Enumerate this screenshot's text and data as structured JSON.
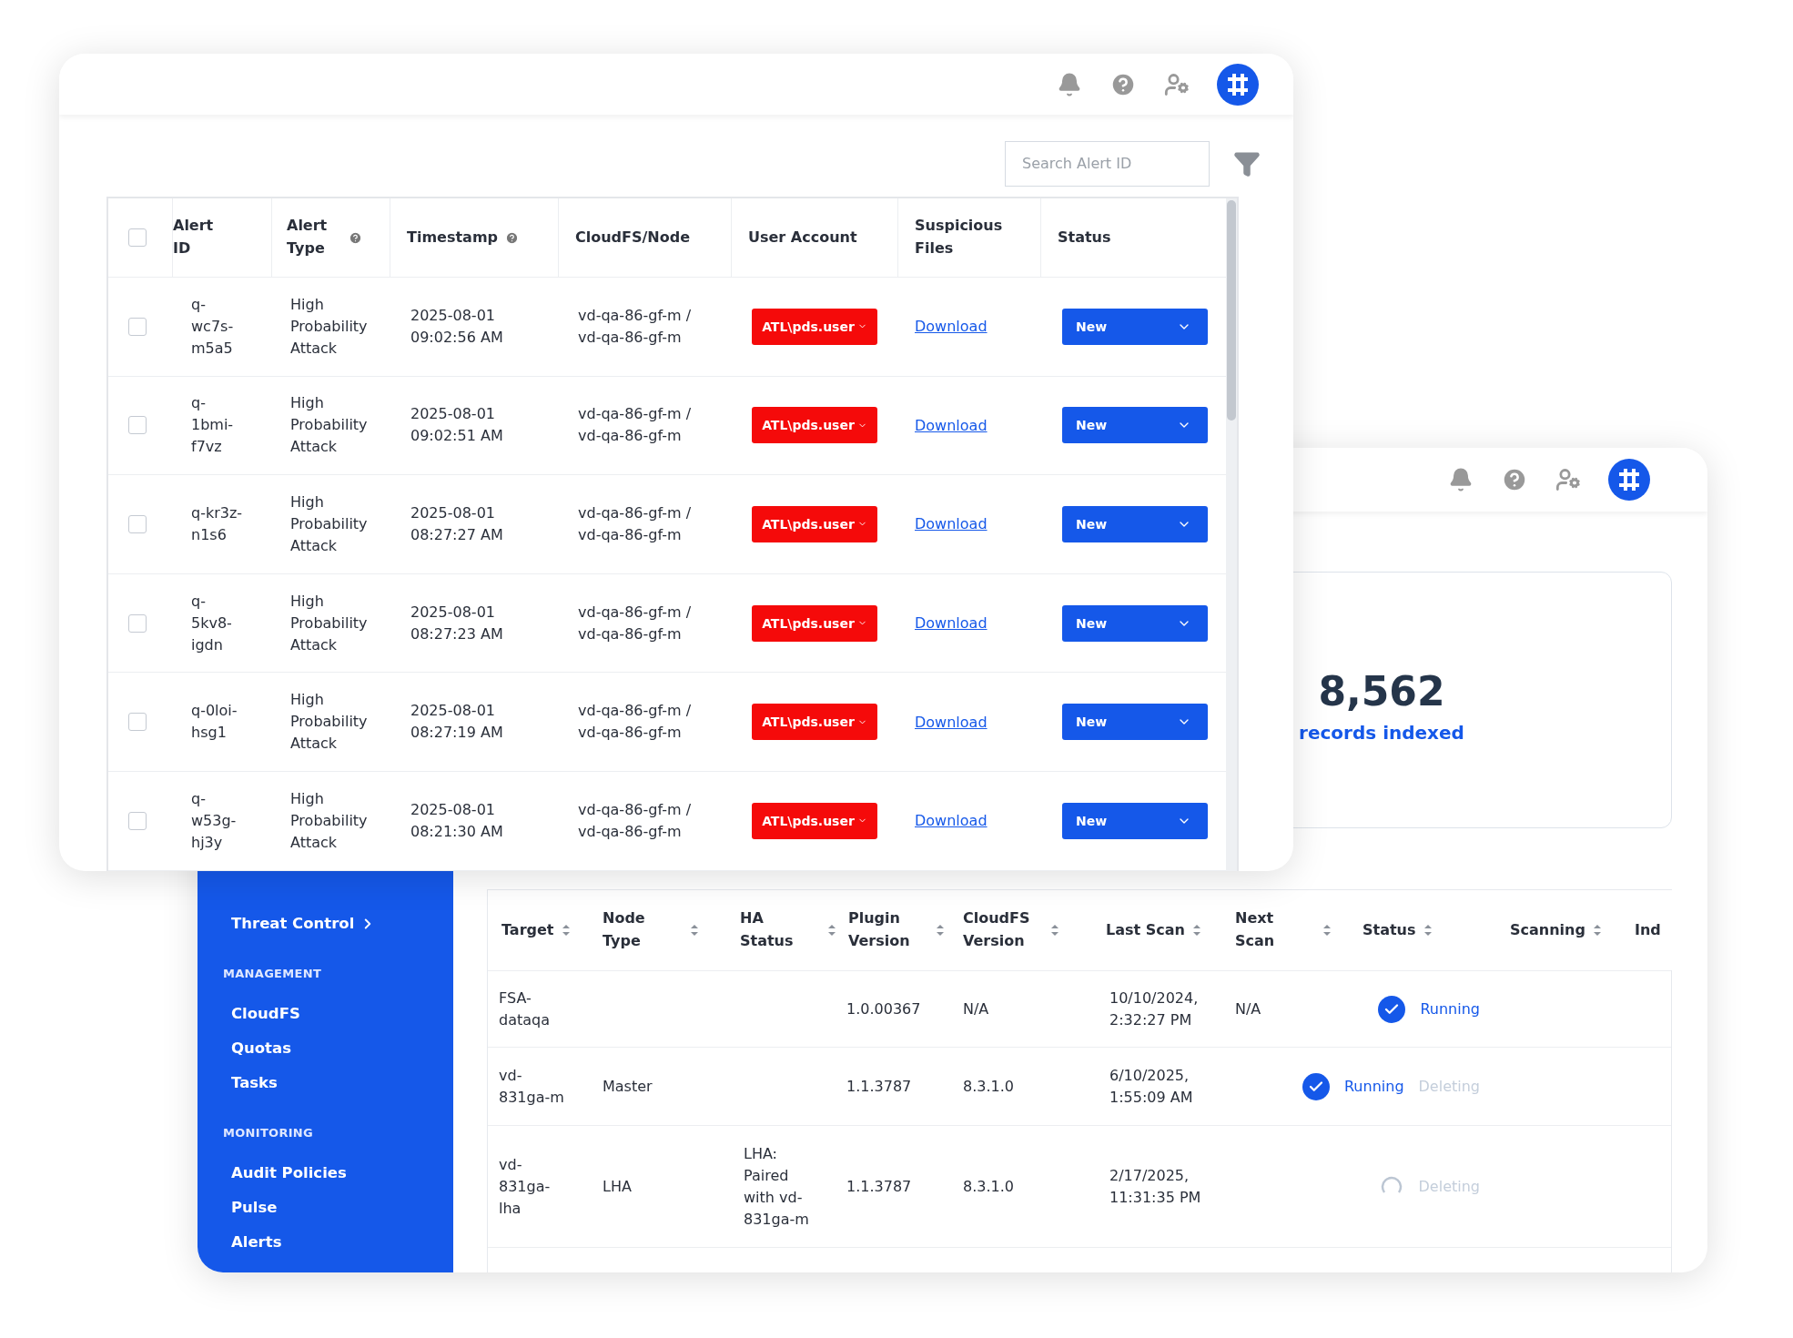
{
  "alerts_window": {
    "search": {
      "placeholder": "Search Alert ID"
    },
    "table": {
      "select_all_checked": false,
      "columns": [
        {
          "label": "Alert ID",
          "help": false
        },
        {
          "label": "Alert Type",
          "help": true
        },
        {
          "label": "Timestamp",
          "help": true
        },
        {
          "label": "CloudFS/Node",
          "help": false
        },
        {
          "label": "User Account",
          "help": false
        },
        {
          "label": "Suspicious Files",
          "help": false
        },
        {
          "label": "Status",
          "help": false
        }
      ],
      "rows": [
        {
          "checked": false,
          "alert_id": "q-wc7s-m5a5",
          "alert_type": "High Probability Attack",
          "timestamp": "2025-08-01 09:02:56 AM",
          "node": "vd-qa-86-gf-m / vd-qa-86-gf-m",
          "user": "ATL\\pds.user",
          "files": "Download",
          "status": "New"
        },
        {
          "checked": false,
          "alert_id": "q-1bmi-f7vz",
          "alert_type": "High Probability Attack",
          "timestamp": "2025-08-01 09:02:51 AM",
          "node": "vd-qa-86-gf-m / vd-qa-86-gf-m",
          "user": "ATL\\pds.user",
          "files": "Download",
          "status": "New"
        },
        {
          "checked": false,
          "alert_id": "q-kr3z-n1s6",
          "alert_type": "High Probability Attack",
          "timestamp": "2025-08-01 08:27:27 AM",
          "node": "vd-qa-86-gf-m / vd-qa-86-gf-m",
          "user": "ATL\\pds.user",
          "files": "Download",
          "status": "New"
        },
        {
          "checked": false,
          "alert_id": "q-5kv8-igdn",
          "alert_type": "High Probability Attack",
          "timestamp": "2025-08-01 08:27:23 AM",
          "node": "vd-qa-86-gf-m / vd-qa-86-gf-m",
          "user": "ATL\\pds.user",
          "files": "Download",
          "status": "New"
        },
        {
          "checked": false,
          "alert_id": "q-0loi-hsg1",
          "alert_type": "High Probability Attack",
          "timestamp": "2025-08-01 08:27:19 AM",
          "node": "vd-qa-86-gf-m / vd-qa-86-gf-m",
          "user": "ATL\\pds.user",
          "files": "Download",
          "status": "New"
        },
        {
          "checked": false,
          "alert_id": "q-w53g-hj3y",
          "alert_type": "High Probability Attack",
          "timestamp": "2025-08-01 08:21:30 AM",
          "node": "vd-qa-86-gf-m / vd-qa-86-gf-m",
          "user": "ATL\\pds.user",
          "files": "Download",
          "status": "New"
        }
      ]
    }
  },
  "nodes_window": {
    "sidebar": {
      "items": [
        {
          "kind": "item",
          "label": "Threat Control",
          "submenu": true
        },
        {
          "kind": "heading",
          "label": "MANAGEMENT"
        },
        {
          "kind": "item",
          "label": "CloudFS",
          "submenu": false
        },
        {
          "kind": "item",
          "label": "Quotas",
          "submenu": false
        },
        {
          "kind": "item",
          "label": "Tasks",
          "submenu": false
        },
        {
          "kind": "heading",
          "label": "MONITORING"
        },
        {
          "kind": "item",
          "label": "Audit Policies",
          "submenu": false
        },
        {
          "kind": "item",
          "label": "Pulse",
          "submenu": false
        },
        {
          "kind": "item",
          "label": "Alerts",
          "submenu": false
        }
      ]
    },
    "stat": {
      "value": "8,562",
      "label": "records indexed"
    },
    "table": {
      "columns": [
        {
          "label": "Target",
          "sortable": true
        },
        {
          "label": "Node Type",
          "sortable": true
        },
        {
          "label": "HA Status",
          "sortable": true
        },
        {
          "label": "Plugin Version",
          "sortable": true
        },
        {
          "label": "CloudFS Version",
          "sortable": true
        },
        {
          "label": "Last Scan",
          "sortable": true
        },
        {
          "label": "Next Scan",
          "sortable": true
        },
        {
          "label": "Status",
          "sortable": true
        },
        {
          "label": "Scanning",
          "sortable": true
        },
        {
          "label": "Ind",
          "sortable": false
        }
      ],
      "rows": [
        {
          "target": "FSA-dataqa",
          "plugin_version": "1.0.00367",
          "cloudfs_version": "N/A",
          "last_scan": "10/10/2024, 2:32:27 PM",
          "next_scan": "N/A",
          "status": {
            "kind": "running",
            "labels": [
              {
                "text": "Running",
                "muted": false
              }
            ]
          }
        },
        {
          "target": "vd-831ga-m",
          "node_type": "Master",
          "plugin_version": "1.1.3787",
          "cloudfs_version": "8.3.1.0",
          "last_scan": "6/10/2025, 1:55:09 AM",
          "status": {
            "kind": "running",
            "labels": [
              {
                "text": "Running",
                "muted": false
              },
              {
                "text": "Deleting",
                "muted": true
              }
            ]
          }
        },
        {
          "target": "vd-831ga-lha",
          "node_type": "LHA",
          "ha_status": "LHA: Paired with vd-831ga-m",
          "plugin_version": "1.1.3787",
          "cloudfs_version": "8.3.1.0",
          "last_scan": "2/17/2025, 11:31:35 PM",
          "status": {
            "kind": "pending",
            "labels": [
              {
                "text": "Deleting",
                "muted": true
              }
            ]
          }
        }
      ]
    }
  }
}
